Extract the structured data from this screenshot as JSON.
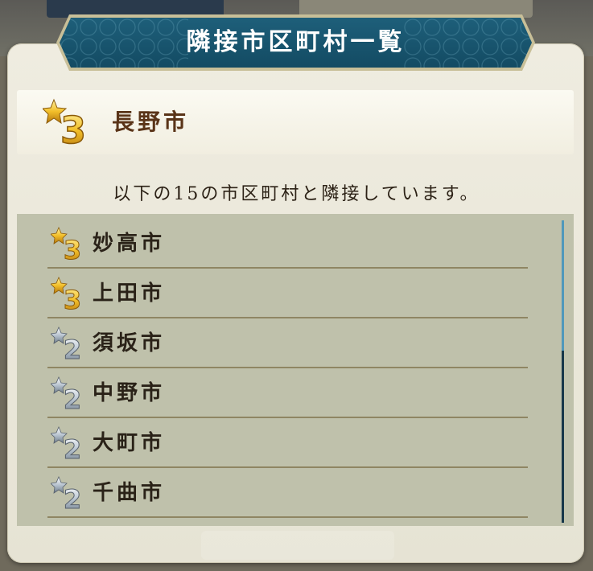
{
  "dialog": {
    "title": "隣接市区町村一覧"
  },
  "selected_city": {
    "rank": "3",
    "name": "長野市"
  },
  "description": "以下の15の市区町村と隣接しています。",
  "neighbors": [
    {
      "rank": "3",
      "name": "妙高市"
    },
    {
      "rank": "3",
      "name": "上田市"
    },
    {
      "rank": "2",
      "name": "須坂市"
    },
    {
      "rank": "2",
      "name": "中野市"
    },
    {
      "rank": "2",
      "name": "大町市"
    },
    {
      "rank": "2",
      "name": "千曲市"
    }
  ],
  "colors": {
    "gold_rank": "#e8b21e",
    "silver_rank": "#aab6c4",
    "title_bg": "#1a5670"
  }
}
